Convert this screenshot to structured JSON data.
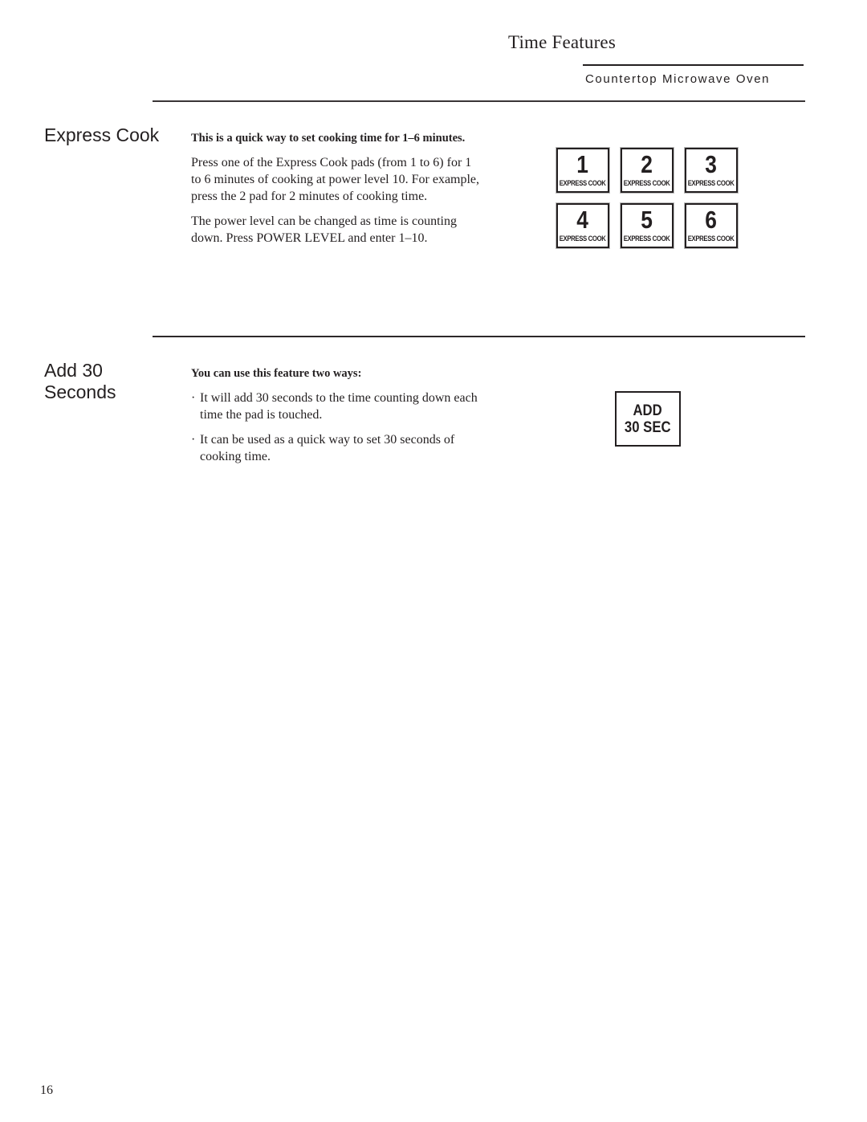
{
  "header": {
    "title": "Time Features",
    "subtitle": "Countertop Microwave Oven"
  },
  "sections": {
    "express_cook": {
      "heading": "Express Cook",
      "lead": "This is a quick way to set cooking time for 1–6 minutes.",
      "paragraphs": [
        "Press one of the Express Cook pads (from 1 to 6) for 1 to 6 minutes of cooking at power level 10. For example, press the 2 pad for 2 minutes of cooking time.",
        "The power level can be changed as time is counting down. Press POWER LEVEL and enter 1–10."
      ],
      "pads": [
        {
          "number": "1",
          "label": "EXPRESS COOK"
        },
        {
          "number": "2",
          "label": "EXPRESS COOK"
        },
        {
          "number": "3",
          "label": "EXPRESS COOK"
        },
        {
          "number": "4",
          "label": "EXPRESS COOK"
        },
        {
          "number": "5",
          "label": "EXPRESS COOK"
        },
        {
          "number": "6",
          "label": "EXPRESS COOK"
        }
      ]
    },
    "add_30_seconds": {
      "heading_line1": "Add 30",
      "heading_line2": "Seconds",
      "lead": "You can use this feature two ways:",
      "bullet_char": "·",
      "bullets": [
        "It will add 30 seconds to the time counting down each time the pad is touched.",
        "It can be used as a quick way to set 30 seconds of cooking time."
      ],
      "pad": {
        "line1": "ADD",
        "line2": "30 SEC"
      }
    }
  },
  "footer": {
    "page_number": "16"
  }
}
